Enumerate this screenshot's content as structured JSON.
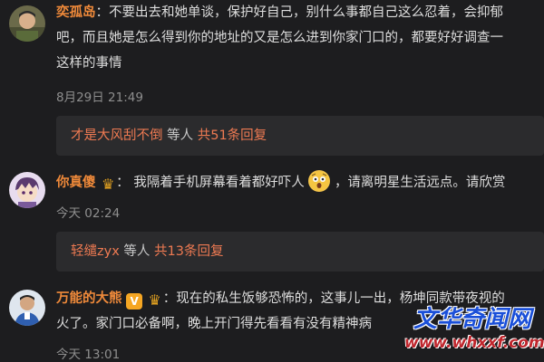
{
  "comments": [
    {
      "username": "奕孤岛",
      "colon": "：",
      "lines": [
        "不要出去和她单谈，保护好自己，别什么事都自己这么忍着，会抑郁",
        "吧，而且她是怎么得到你的地址的又是怎么进到你家门口的，都要好好调查一",
        "这样的事情"
      ],
      "time": "8月29日 21:49",
      "reply": {
        "name": "才是大风刮不倒",
        "mid": " 等人 ",
        "count": "共51条回复"
      }
    },
    {
      "username": "你真傻",
      "colon": "：",
      "text_before_emoji": "我隔着手机屏幕看着都好吓人",
      "text_after_emoji": "，请离明星生活远点。请欣赏",
      "time": "今天 02:24",
      "reply": {
        "name": "轻缱zyx",
        "mid": " 等人 ",
        "count": "共13条回复"
      }
    },
    {
      "username": "万能的大熊",
      "badge_v": "V",
      "colon": "：",
      "lines": [
        "现在的私生饭够恐怖的，这事儿一出，杨坤同款带夜视的",
        "火了。家门口必备啊，晚上开门得先看看有没有精神病"
      ],
      "time": "今天 13:01"
    }
  ],
  "watermark": {
    "title": "文华奇闻网",
    "url": "www.whxxf.com"
  }
}
